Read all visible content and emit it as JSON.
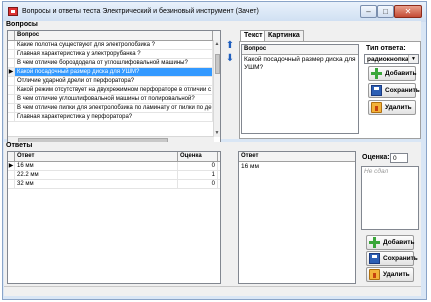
{
  "window": {
    "title": "Вопросы и ответы теста Электрический и безиновый инструмент (Зачет)",
    "controls": [
      "minimize",
      "maximize",
      "close"
    ]
  },
  "questions": {
    "section_label": "Вопросы",
    "column_header": "Вопрос",
    "rows": [
      "Какие полотна существуют для электролобзика ?",
      "Главная характеристика у электрорубанка ?",
      "В чем отличие бороздодела от углошлифовальной машины?",
      "Какой посадочный размер диска для УШМ?",
      "Отличие ударной дрели от перфоратора?",
      "Какой режим отсутствует на двухрежимном перфораторе в отличии с",
      "В чем отличие углошлифовальной машины от полировальной?",
      "В чем отличие пилки для электролобзика по ламинату от пилки по де",
      "Главная характеристика у перфоратора?"
    ],
    "selected_index": 3,
    "move_up_icon": "arrow-up-icon",
    "move_down_icon": "arrow-down-icon"
  },
  "question_editor": {
    "tabs": [
      "Текст",
      "Картинка"
    ],
    "active_tab": "Текст",
    "text_header": "Вопрос",
    "text_value": "Какой посадочный размер диска для УШМ?",
    "answer_type_label": "Тип ответа:",
    "answer_type_value": "радиокнопка",
    "buttons": {
      "add": "Добавить",
      "save": "Сохранить",
      "delete": "Удалить"
    }
  },
  "answers": {
    "section_label": "Ответы",
    "columns": [
      "Ответ",
      "Оценка"
    ],
    "rows": [
      {
        "answer": "16 мм",
        "score": "0"
      },
      {
        "answer": "22.2 мм",
        "score": "1"
      },
      {
        "answer": "32 мм",
        "score": "0"
      }
    ],
    "current_index": 0
  },
  "answer_editor": {
    "header": "Ответ",
    "text_value": "16 мм",
    "score_label": "Оценка:",
    "score_value": "0",
    "comment_placeholder": "Не сдал",
    "buttons": {
      "add": "Добавить",
      "save": "Сохранить",
      "delete": "Удалить"
    }
  },
  "colors": {
    "selection": "#3399ff",
    "frame": "#d9e6f5",
    "close_button": "#c44b35"
  }
}
